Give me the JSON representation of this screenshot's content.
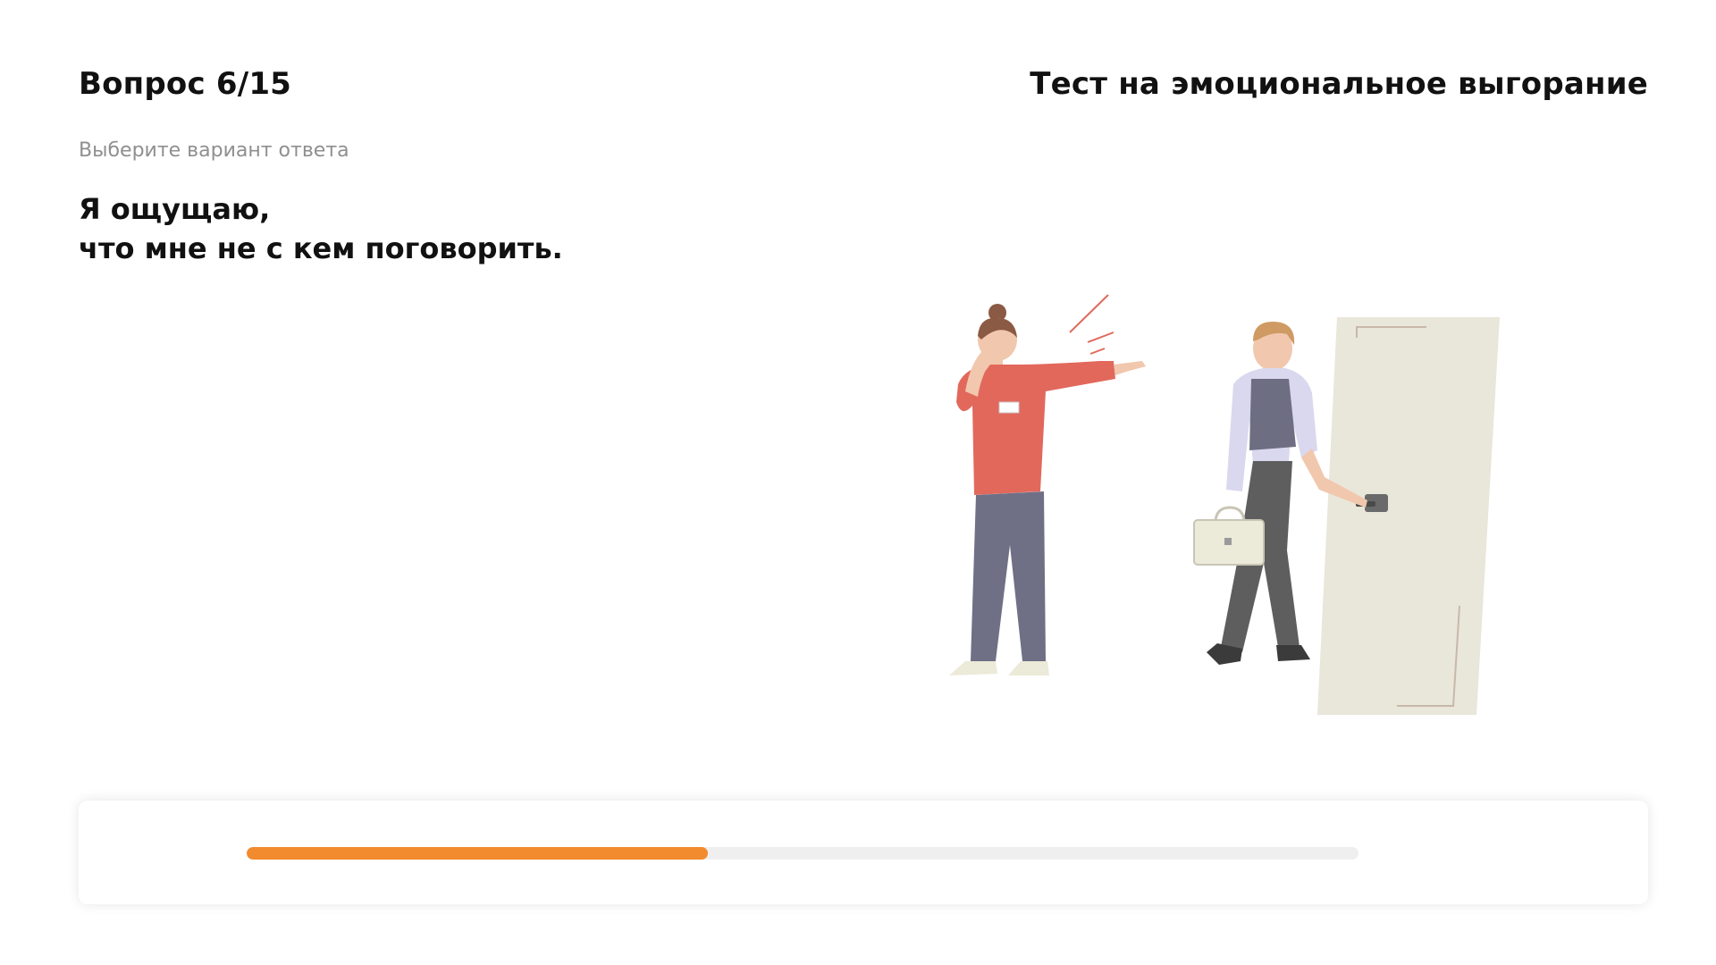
{
  "header": {
    "question_counter": "Вопрос 6/15",
    "test_title": "Тест на эмоциональное выгорание"
  },
  "prompt": {
    "hint": "Выберите вариант ответа",
    "question_lines": [
      "Я ощущаю,",
      "что мне не с кем поговорить."
    ]
  },
  "illustration": {
    "icon": "office-scene-illustration"
  },
  "progress": {
    "fraction": 0.415,
    "fill_color": "#f28a2e",
    "track_color": "#efefef"
  }
}
